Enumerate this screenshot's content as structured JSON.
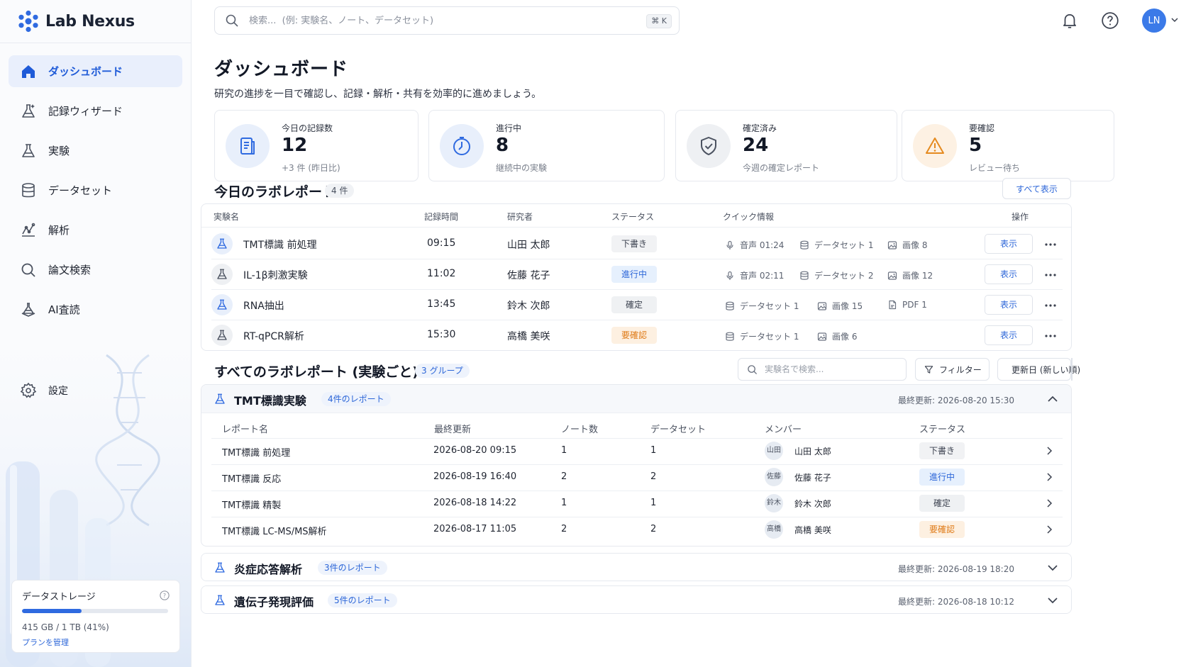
{
  "brand": {
    "name": "Lab Nexus"
  },
  "sidebar": {
    "items": [
      {
        "label": "ダッシュボード",
        "active": true
      },
      {
        "label": "記録ウィザード"
      },
      {
        "label": "実験"
      },
      {
        "label": "データセット"
      },
      {
        "label": "解析"
      },
      {
        "label": "論文検索"
      },
      {
        "label": "AI査読"
      }
    ],
    "settings_label": "設定",
    "storage": {
      "title": "データストレージ",
      "used_fraction": 0.41,
      "text": "415 GB / 1 TB (41%)",
      "link": "プランを管理"
    }
  },
  "topbar": {
    "search_placeholder": "検索...  (例: 実験名、ノート、データセット)",
    "shortcut": "⌘ K",
    "avatar_initials": "LN"
  },
  "page": {
    "title": "ダッシュボード",
    "subtitle": "研究の進捗を一目で確認し、記録・解析・共有を効率的に進めましょう。"
  },
  "stats": [
    {
      "label": "今日の記録数",
      "value": "12",
      "note": "+3 件 (昨日比)"
    },
    {
      "label": "進行中",
      "value": "8",
      "note": "継続中の実験"
    },
    {
      "label": "確定済み",
      "value": "24",
      "note": "今週の確定レポート"
    },
    {
      "label": "要確認",
      "value": "5",
      "note": "レビュー待ち"
    }
  ],
  "today": {
    "title": "今日のラボレポート",
    "count": "4 件",
    "view_all": "すべて表示",
    "headers": [
      "実験名",
      "記録時間",
      "研究者",
      "ステータス",
      "クイック情報",
      "操作"
    ],
    "view_label": "表示",
    "rows": [
      {
        "name": "TMT標識 前処理",
        "time": "09:15",
        "researcher": "山田 太郎",
        "status": "下書き",
        "quick": [
          "音声 01:24",
          "データセット 1",
          "画像 8"
        ]
      },
      {
        "name": "IL-1β刺激実験",
        "time": "11:02",
        "researcher": "佐藤 花子",
        "status": "進行中",
        "quick": [
          "音声 02:11",
          "データセット 2",
          "画像 12"
        ]
      },
      {
        "name": "RNA抽出",
        "time": "13:45",
        "researcher": "鈴木 次郎",
        "status": "確定",
        "quick": [
          "データセット 1",
          "画像 15",
          "PDF 1"
        ]
      },
      {
        "name": "RT-qPCR解析",
        "time": "15:30",
        "researcher": "高橋 美咲",
        "status": "要確認",
        "quick": [
          "データセット 1",
          "画像 6"
        ]
      }
    ]
  },
  "all": {
    "title": "すべてのラボレポート (実験ごと)",
    "count": "3 グループ",
    "search_placeholder": "実験名で検索...",
    "filter_label": "フィルター",
    "sort_label": "更新日 (新しい順)",
    "group_headers": [
      "レポート名",
      "最終更新",
      "ノート数",
      "データセット",
      "メンバー",
      "ステータス"
    ],
    "groups": [
      {
        "name": "TMT標識実験",
        "reports": "4件のレポート",
        "updated": "最終更新: 2026-08-20 15:30",
        "expanded": true,
        "rows": [
          {
            "name": "TMT標識 前処理",
            "updated": "2026-08-20 09:15",
            "notes": "1",
            "datasets": "1",
            "avatar": "山田",
            "member": "山田 太郎",
            "status": "下書き"
          },
          {
            "name": "TMT標識 反応",
            "updated": "2026-08-19 16:40",
            "notes": "2",
            "datasets": "2",
            "avatar": "佐藤",
            "member": "佐藤 花子",
            "status": "進行中"
          },
          {
            "name": "TMT標識 精製",
            "updated": "2026-08-18 14:22",
            "notes": "1",
            "datasets": "1",
            "avatar": "鈴木",
            "member": "鈴木 次郎",
            "status": "確定"
          },
          {
            "name": "TMT標識 LC-MS/MS解析",
            "updated": "2026-08-17 11:05",
            "notes": "2",
            "datasets": "2",
            "avatar": "高橋",
            "member": "高橋 美咲",
            "status": "要確認"
          }
        ]
      },
      {
        "name": "炎症応答解析",
        "reports": "3件のレポート",
        "updated": "最終更新: 2026-08-19 18:20",
        "expanded": false
      },
      {
        "name": "遺伝子発現評価",
        "reports": "5件のレポート",
        "updated": "最終更新: 2026-08-18 10:12",
        "expanded": false
      }
    ]
  },
  "colors": {
    "accent": "#2c66d8",
    "draft": "#f1f2f4",
    "progress": "#e6f0fd",
    "review": "#fdf0e1"
  },
  "icons": [
    "home-icon",
    "wizard-icon",
    "flask-icon",
    "database-icon",
    "analysis-icon",
    "search-icon",
    "ai-review-icon",
    "gear-icon",
    "bell-icon",
    "help-icon",
    "document-icon",
    "clock-icon",
    "shield-icon",
    "warning-icon",
    "mic-icon",
    "image-icon",
    "pdf-icon",
    "filter-icon",
    "sort-icon",
    "chevron-icon",
    "more-icon"
  ]
}
